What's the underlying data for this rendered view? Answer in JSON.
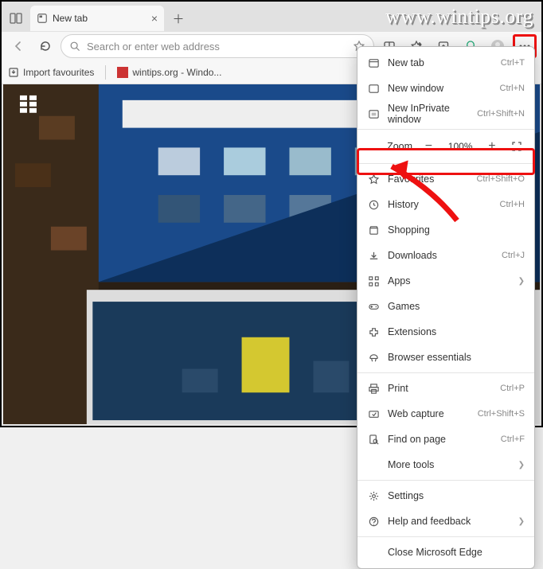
{
  "watermark": "www.wintips.org",
  "tab": {
    "title": "New tab"
  },
  "address": {
    "placeholder": "Search or enter web address"
  },
  "bookmarks": {
    "import": "Import favourites",
    "wintips": "wintips.org - Windo..."
  },
  "menu": {
    "newtab": {
      "label": "New tab",
      "shortcut": "Ctrl+T"
    },
    "newwindow": {
      "label": "New window",
      "shortcut": "Ctrl+N"
    },
    "inprivate": {
      "label": "New InPrivate window",
      "shortcut": "Ctrl+Shift+N"
    },
    "zoom": {
      "label": "Zoom",
      "pct": "100%"
    },
    "favourites": {
      "label": "Favourites",
      "shortcut": "Ctrl+Shift+O"
    },
    "history": {
      "label": "History",
      "shortcut": "Ctrl+H"
    },
    "shopping": {
      "label": "Shopping"
    },
    "downloads": {
      "label": "Downloads",
      "shortcut": "Ctrl+J"
    },
    "apps": {
      "label": "Apps"
    },
    "games": {
      "label": "Games"
    },
    "extensions": {
      "label": "Extensions"
    },
    "essentials": {
      "label": "Browser essentials"
    },
    "print": {
      "label": "Print",
      "shortcut": "Ctrl+P"
    },
    "capture": {
      "label": "Web capture",
      "shortcut": "Ctrl+Shift+S"
    },
    "find": {
      "label": "Find on page",
      "shortcut": "Ctrl+F"
    },
    "moretools": {
      "label": "More tools"
    },
    "settings": {
      "label": "Settings"
    },
    "help": {
      "label": "Help and feedback"
    },
    "close": {
      "label": "Close Microsoft Edge"
    }
  }
}
